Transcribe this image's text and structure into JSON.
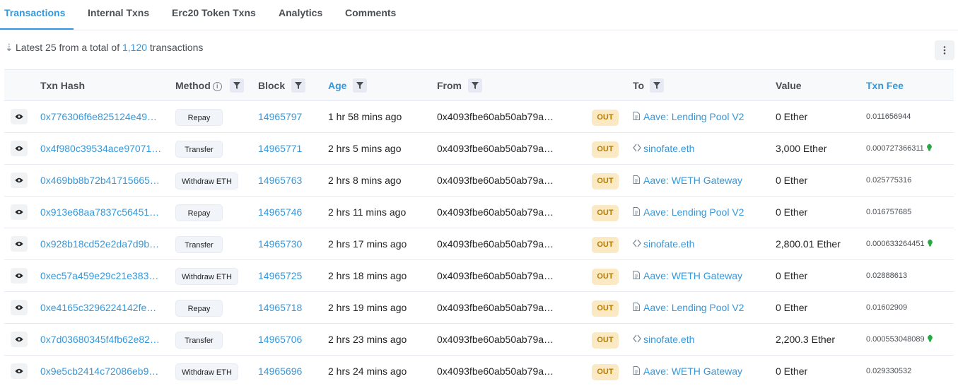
{
  "tabs": [
    {
      "label": "Transactions",
      "active": true
    },
    {
      "label": "Internal Txns",
      "active": false
    },
    {
      "label": "Erc20 Token Txns",
      "active": false
    },
    {
      "label": "Analytics",
      "active": false
    },
    {
      "label": "Comments",
      "active": false
    }
  ],
  "summary": {
    "prefix": "Latest 25 from a total of",
    "count": "1,120",
    "suffix": "transactions"
  },
  "columns": {
    "txn_hash": "Txn Hash",
    "method": "Method",
    "block": "Block",
    "age": "Age",
    "from": "From",
    "to": "To",
    "value": "Value",
    "txn_fee": "Txn Fee"
  },
  "rows": [
    {
      "hash": "0x776306f6e825124e49…",
      "method": "Repay",
      "block": "14965797",
      "age": "1 hr 58 mins ago",
      "from": "0x4093fbe60ab50ab79a…",
      "direction": "OUT",
      "to_icon": "contract-icon",
      "to": "Aave: Lending Pool V2",
      "value": "0 Ether",
      "fee": "0.011656944",
      "gas_icon": false
    },
    {
      "hash": "0x4f980c39534ace97071…",
      "method": "Transfer",
      "block": "14965771",
      "age": "2 hrs 5 mins ago",
      "from": "0x4093fbe60ab50ab79a…",
      "direction": "OUT",
      "to_icon": "ens-icon",
      "to": "sinofate.eth",
      "value": "3,000 Ether",
      "fee": "0.000727366311",
      "gas_icon": true
    },
    {
      "hash": "0x469bb8b72b41715665…",
      "method": "Withdraw ETH",
      "block": "14965763",
      "age": "2 hrs 8 mins ago",
      "from": "0x4093fbe60ab50ab79a…",
      "direction": "OUT",
      "to_icon": "contract-icon",
      "to": "Aave: WETH Gateway",
      "value": "0 Ether",
      "fee": "0.025775316",
      "gas_icon": false
    },
    {
      "hash": "0x913e68aa7837c56451…",
      "method": "Repay",
      "block": "14965746",
      "age": "2 hrs 11 mins ago",
      "from": "0x4093fbe60ab50ab79a…",
      "direction": "OUT",
      "to_icon": "contract-icon",
      "to": "Aave: Lending Pool V2",
      "value": "0 Ether",
      "fee": "0.016757685",
      "gas_icon": false
    },
    {
      "hash": "0x928b18cd52e2da7d9b…",
      "method": "Transfer",
      "block": "14965730",
      "age": "2 hrs 17 mins ago",
      "from": "0x4093fbe60ab50ab79a…",
      "direction": "OUT",
      "to_icon": "ens-icon",
      "to": "sinofate.eth",
      "value": "2,800.01 Ether",
      "fee": "0.000633264451",
      "gas_icon": true
    },
    {
      "hash": "0xec57a459e29c21e383…",
      "method": "Withdraw ETH",
      "block": "14965725",
      "age": "2 hrs 18 mins ago",
      "from": "0x4093fbe60ab50ab79a…",
      "direction": "OUT",
      "to_icon": "contract-icon",
      "to": "Aave: WETH Gateway",
      "value": "0 Ether",
      "fee": "0.02888613",
      "gas_icon": false
    },
    {
      "hash": "0xe4165c3296224142fe…",
      "method": "Repay",
      "block": "14965718",
      "age": "2 hrs 19 mins ago",
      "from": "0x4093fbe60ab50ab79a…",
      "direction": "OUT",
      "to_icon": "contract-icon",
      "to": "Aave: Lending Pool V2",
      "value": "0 Ether",
      "fee": "0.01602909",
      "gas_icon": false
    },
    {
      "hash": "0x7d03680345f4fb62e82…",
      "method": "Transfer",
      "block": "14965706",
      "age": "2 hrs 23 mins ago",
      "from": "0x4093fbe60ab50ab79a…",
      "direction": "OUT",
      "to_icon": "ens-icon",
      "to": "sinofate.eth",
      "value": "2,200.3 Ether",
      "fee": "0.000553048089",
      "gas_icon": true
    },
    {
      "hash": "0x9e5cb2414c72086eb9…",
      "method": "Withdraw ETH",
      "block": "14965696",
      "age": "2 hrs 24 mins ago",
      "from": "0x4093fbe60ab50ab79a…",
      "direction": "OUT",
      "to_icon": "contract-icon",
      "to": "Aave: WETH Gateway",
      "value": "0 Ether",
      "fee": "0.029330532",
      "gas_icon": false
    }
  ],
  "colors": {
    "accent": "#3498db",
    "out_badge_bg": "#fbe9c4",
    "out_badge_text": "#b47d00",
    "gas_icon": "#28a745"
  }
}
